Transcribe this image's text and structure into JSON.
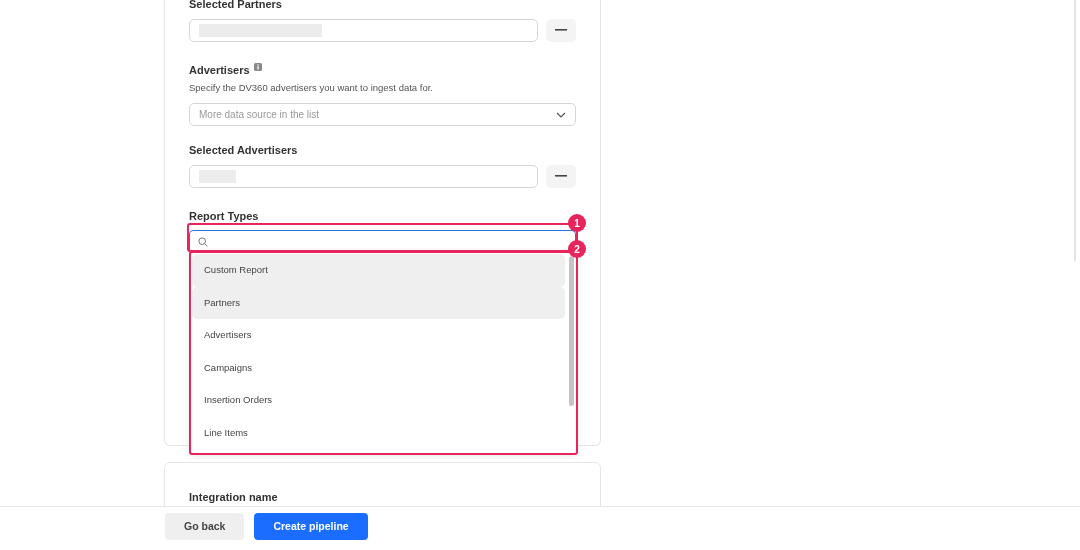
{
  "partners": {
    "selected_label": "Selected Partners"
  },
  "advertisers": {
    "label": "Advertisers",
    "help": "Specify the DV360 advertisers you want to ingest data for.",
    "select": {
      "placeholder": "More data source in the list"
    },
    "selected_label": "Selected Advertisers"
  },
  "report_types": {
    "label": "Report Types",
    "search": {
      "callout": "1"
    },
    "dropdown": {
      "callout": "2",
      "items": [
        {
          "label": "Custom Report",
          "highlighted": true
        },
        {
          "label": "Partners",
          "highlighted": true
        },
        {
          "label": "Advertisers",
          "highlighted": false
        },
        {
          "label": "Campaigns",
          "highlighted": false
        },
        {
          "label": "Insertion Orders",
          "highlighted": false
        },
        {
          "label": "Line Items",
          "highlighted": false
        }
      ]
    }
  },
  "integration": {
    "label": "Integration name"
  },
  "footer": {
    "buttons": [
      {
        "label": "Go back",
        "kind": "secondary"
      },
      {
        "label": "Create pipeline",
        "kind": "primary"
      }
    ]
  }
}
